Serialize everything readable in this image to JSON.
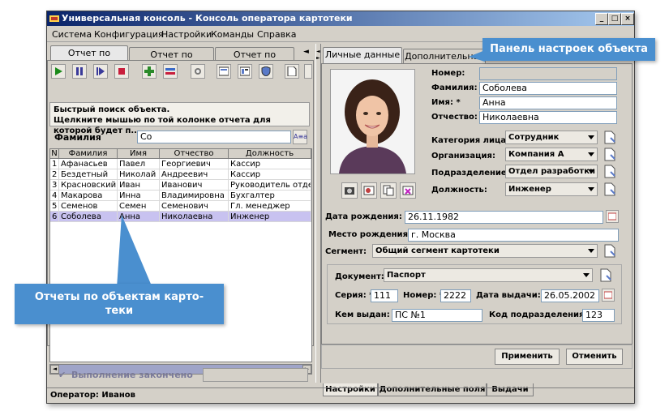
{
  "window": {
    "title": "Универсальная консоль - Консоль оператора картотеки",
    "btn_min": "_",
    "btn_max": "□",
    "btn_close": "×"
  },
  "menu": [
    "Система",
    "Конфигурация",
    "Настройки",
    "Команды",
    "Справка"
  ],
  "left": {
    "tabs": [
      "Отчет по людям",
      "Отчет по выдачам",
      "Отчет по картам"
    ],
    "hint_line1": "Быстрый поиск объекта.",
    "hint_line2": "Щелкните мышью по той колонке отчета для которой будет п...",
    "search_label": "Фамилия",
    "search_value": "Со",
    "search_btn": "A≡a",
    "columns": [
      "N",
      "Фамилия",
      "Имя",
      "Отчество",
      "Должность"
    ],
    "rows": [
      [
        "1",
        "Афанасьев",
        "Павел",
        "Георгиевич",
        "Кассир"
      ],
      [
        "2",
        "Бездетный",
        "Николай",
        "Андреевич",
        "Кассир"
      ],
      [
        "3",
        "Красновский",
        "Иван",
        "Иванович",
        "Руководитель отдела"
      ],
      [
        "4",
        "Макарова",
        "Инна",
        "Владимировна",
        "Бухгалтер"
      ],
      [
        "5",
        "Семенов",
        "Семен",
        "Семенович",
        "Гл. менеджер"
      ],
      [
        "6",
        "Соболева",
        "Анна",
        "Николаевна",
        "Инженер"
      ]
    ],
    "status": "Выполнение закончено"
  },
  "right": {
    "tabs": [
      "Личные данные",
      "Дополнительная и"
    ],
    "labels": {
      "number": "Номер:",
      "surname": "Фамилия: *",
      "name": "Имя: *",
      "patronymic": "Отчество: *",
      "category": "Категория лица: *",
      "org": "Организация:",
      "dept": "Подразделение:",
      "position": "Должность:",
      "birth_date": "Дата рождения: *",
      "birth_place": "Место рождения: *",
      "segment": "Сегмент:",
      "document": "Документ: *",
      "series": "Серия: *",
      "doc_number": "Номер: *",
      "issue_date": "Дата выдачи: *",
      "issued_by": "Кем выдан: *",
      "dept_code": "Код подразделения: *"
    },
    "values": {
      "number": "",
      "surname": "Соболева",
      "name": "Анна",
      "patronymic": "Николаевна",
      "category": "Сотрудник",
      "org": "Компания А",
      "dept": "Отдел разработки",
      "position": "Инженер",
      "birth_date": "26.11.1982",
      "birth_place": "г. Москва",
      "segment": "Общий сегмент картотеки",
      "document": "Паспорт",
      "series": "111",
      "doc_number": "2222",
      "issue_date": "26.05.2002",
      "issued_by": "ПС №1",
      "dept_code": "123"
    },
    "apply": "Применить",
    "cancel": "Отменить",
    "bottom_tabs": [
      "Настройки",
      "Дополнительные поля",
      "Выдачи"
    ]
  },
  "statusbar": "Оператор: Иванов",
  "callouts": {
    "settings_panel": "Панель настроек объекта",
    "reports_line1": "Отчеты по объектам карто-",
    "reports_line2": "теки"
  },
  "colors": {
    "callout": "#4a8fcf",
    "selected_row": "#c8c2f0",
    "title_start": "#0a246a"
  }
}
